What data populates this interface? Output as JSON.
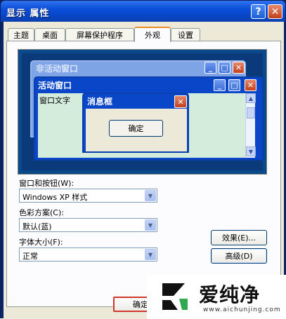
{
  "window": {
    "title": "显示 属性",
    "help_label": "?",
    "close_label": "✕"
  },
  "tabs": [
    {
      "label": "主题"
    },
    {
      "label": "桌面"
    },
    {
      "label": "屏幕保护程序"
    },
    {
      "label": "外观",
      "active": true
    },
    {
      "label": "设置"
    }
  ],
  "preview": {
    "inactive_title": "非活动窗口",
    "active_title": "活动窗口",
    "window_text": "窗口文字",
    "msgbox_title": "消息框",
    "msgbox_ok": "确定"
  },
  "fields": {
    "windows_buttons": {
      "label": "窗口和按钮(W):",
      "value": "Windows XP 样式"
    },
    "color_scheme": {
      "label": "色彩方案(C):",
      "value": "默认(蓝)"
    },
    "font_size": {
      "label": "字体大小(F):",
      "value": "正常"
    }
  },
  "buttons": {
    "effects": "效果(E)...",
    "advanced": "高级(D)",
    "ok": "确定"
  },
  "watermark": {
    "brand": "爱纯净",
    "url": "www.aichunjing.com"
  },
  "colors": {
    "titlebar": "#0b4ed8",
    "tab_highlight": "#e68b2c",
    "window_text_bg": "#d4ecdc",
    "dialog_bg": "#ece9d8"
  }
}
